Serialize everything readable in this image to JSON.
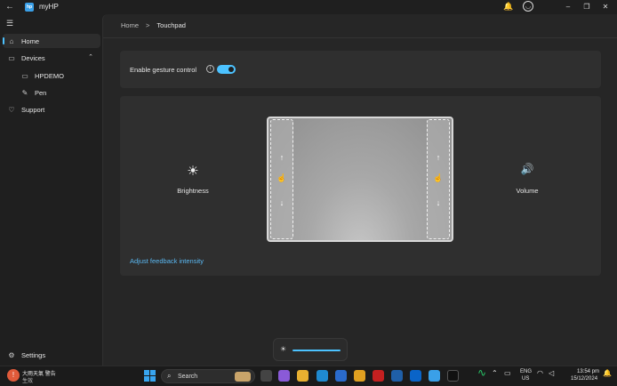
{
  "titlebar": {
    "app_title": "myHP",
    "logo_text": "hp",
    "back_glyph": "←",
    "bell_glyph": "🔔",
    "user_glyph": "◯",
    "minimize_glyph": "–",
    "maximize_glyph": "❐",
    "close_glyph": "✕"
  },
  "sidebar": {
    "menu_glyph": "☰",
    "items": [
      {
        "label": "Home",
        "icon": "home-icon",
        "glyph": "⌂"
      },
      {
        "label": "Devices",
        "icon": "devices-icon",
        "glyph": "▭",
        "chevron": "⌃"
      },
      {
        "label": "HPDEMO",
        "icon": "laptop-icon",
        "glyph": "▭"
      },
      {
        "label": "Pen",
        "icon": "pen-icon",
        "glyph": "✎"
      },
      {
        "label": "Support",
        "icon": "support-icon",
        "glyph": "♡"
      },
      {
        "label": "Settings",
        "icon": "gear-icon",
        "glyph": "⚙"
      }
    ]
  },
  "breadcrumb": {
    "home": "Home",
    "sep": ">",
    "current": "Touchpad"
  },
  "gesture": {
    "label": "Enable gesture control",
    "info_glyph": "i",
    "enabled": true
  },
  "touchpad": {
    "brightness_label": "Brightness",
    "brightness_glyph": "☀",
    "volume_label": "Volume",
    "volume_glyph": "🔊",
    "up_glyph": "↑",
    "down_glyph": "↓",
    "finger_glyph": "☝",
    "feedback_link": "Adjust feedback intensity"
  },
  "brightness_popup": {
    "sun_glyph": "☀",
    "level": 1.0
  },
  "taskbar": {
    "weather_line1": "大雨天氣 警告",
    "weather_line2": "生效",
    "search_label": "Search",
    "search_glyph": "⌕",
    "lang": "ENG",
    "region": "US",
    "time": "13:54 pm",
    "date": "15/12/2024"
  },
  "colors": {
    "accent": "#4cc2ff",
    "link": "#5ab8f2"
  }
}
